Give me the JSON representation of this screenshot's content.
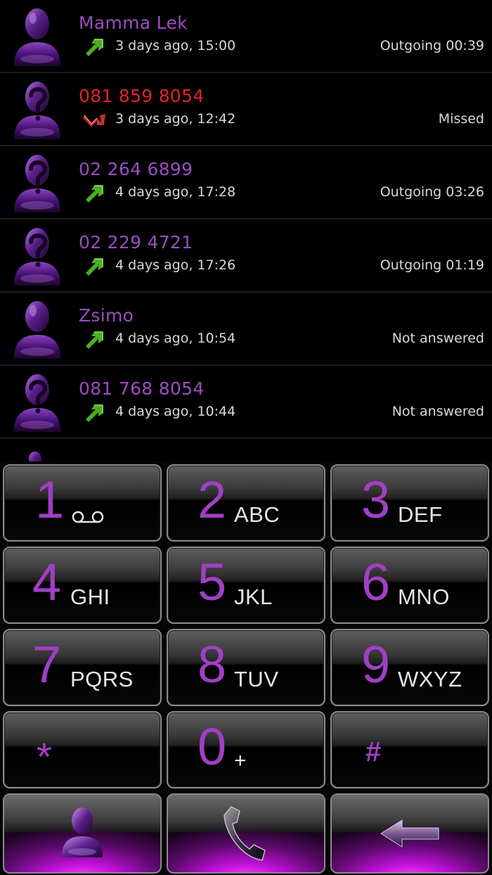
{
  "call_log": [
    {
      "name": "Mamma Lek",
      "time": "3 days ago, 15:00",
      "status": "Outgoing 00:39",
      "type": "outgoing",
      "contact_known": true
    },
    {
      "name": "081 859 8054",
      "time": "3 days ago, 12:42",
      "status": "Missed",
      "type": "missed",
      "contact_known": false
    },
    {
      "name": "02 264 6899",
      "time": "4 days ago, 17:28",
      "status": "Outgoing 03:26",
      "type": "outgoing",
      "contact_known": false
    },
    {
      "name": "02 229 4721",
      "time": "4 days ago, 17:26",
      "status": "Outgoing 01:19",
      "type": "outgoing",
      "contact_known": false
    },
    {
      "name": "Zsimo",
      "time": "4 days ago, 10:54",
      "status": "Not answered",
      "type": "outgoing",
      "contact_known": true
    },
    {
      "name": "081 768 8054",
      "time": "4 days ago, 10:44",
      "status": "Not answered",
      "type": "outgoing",
      "contact_known": false
    }
  ],
  "dialpad": {
    "keys": [
      {
        "digit": "1",
        "letters": ""
      },
      {
        "digit": "2",
        "letters": "ABC"
      },
      {
        "digit": "3",
        "letters": "DEF"
      },
      {
        "digit": "4",
        "letters": "GHI"
      },
      {
        "digit": "5",
        "letters": "JKL"
      },
      {
        "digit": "6",
        "letters": "MNO"
      },
      {
        "digit": "7",
        "letters": "PQRS"
      },
      {
        "digit": "8",
        "letters": "TUV"
      },
      {
        "digit": "9",
        "letters": "WXYZ"
      },
      {
        "digit": "*",
        "letters": ""
      },
      {
        "digit": "0",
        "letters": "+"
      },
      {
        "digit": "#",
        "letters": ""
      }
    ],
    "actions": {
      "contacts_icon": "person-icon",
      "call_icon": "phone-handset-icon",
      "delete_icon": "backspace-arrow-icon"
    }
  },
  "colors": {
    "accent": "#a03fc4",
    "name_text": "#9b4dc0",
    "missed_text": "#e0242a",
    "secondary_text": "#d8d8d8",
    "outgoing_arrow": "#4caf20",
    "missed_arrow": "#c03030"
  }
}
